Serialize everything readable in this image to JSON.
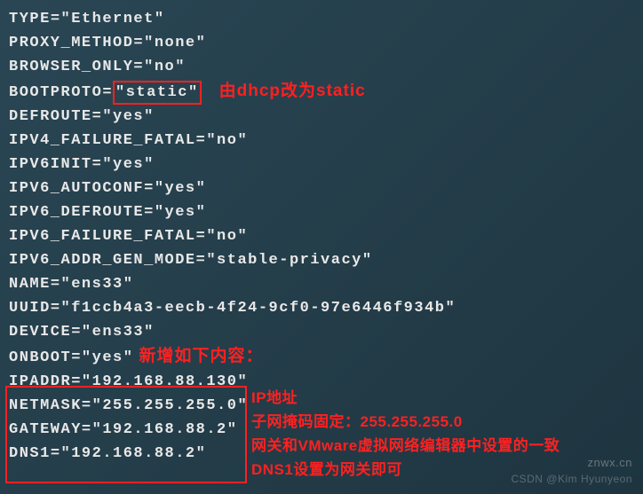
{
  "config": {
    "type": {
      "key": "TYPE",
      "val": "\"Ethernet\""
    },
    "proxy_method": {
      "key": "PROXY_METHOD",
      "val": "\"none\""
    },
    "browser_only": {
      "key": "BROWSER_ONLY",
      "val": "\"no\""
    },
    "bootproto": {
      "key": "BOOTPROTO",
      "val": "\"static\""
    },
    "defroute": {
      "key": "DEFROUTE",
      "val": "\"yes\""
    },
    "ipv4_failure_fatal": {
      "key": "IPV4_FAILURE_FATAL",
      "val": "\"no\""
    },
    "ipv6init": {
      "key": "IPV6INIT",
      "val": "\"yes\""
    },
    "ipv6_autoconf": {
      "key": "IPV6_AUTOCONF",
      "val": "\"yes\""
    },
    "ipv6_defroute": {
      "key": "IPV6_DEFROUTE",
      "val": "\"yes\""
    },
    "ipv6_failure_fatal": {
      "key": "IPV6_FAILURE_FATAL",
      "val": "\"no\""
    },
    "ipv6_addr_gen_mode": {
      "key": "IPV6_ADDR_GEN_MODE",
      "val": "\"stable-privacy\""
    },
    "name": {
      "key": "NAME",
      "val": "\"ens33\""
    },
    "uuid": {
      "key": "UUID",
      "val": "\"f1ccb4a3-eecb-4f24-9cf0-97e6446f934b\""
    },
    "device": {
      "key": "DEVICE",
      "val": "\"ens33\""
    },
    "onboot": {
      "key": "ONBOOT",
      "val": "\"yes\""
    },
    "ipaddr": {
      "key": "IPADDR",
      "val": "\"192.168.88.130\""
    },
    "netmask": {
      "key": "NETMASK",
      "val": "\"255.255.255.0\""
    },
    "gateway": {
      "key": "GATEWAY",
      "val": "\"192.168.88.2\""
    },
    "dns1": {
      "key": "DNS1",
      "val": "\"192.168.88.2\""
    }
  },
  "annotations": {
    "bootproto_note": "由dhcp改为static",
    "new_section_note": "新增如下内容：",
    "ipaddr_note": "IP地址",
    "netmask_note": "子网掩码固定：255.255.255.0",
    "gateway_note": "网关和VMware虚拟网络编辑器中设置的一致",
    "dns1_note": "DNS1设置为网关即可"
  },
  "watermark": {
    "line1": "znwx.cn",
    "line2": "CSDN @Kim Hyunyeon"
  }
}
